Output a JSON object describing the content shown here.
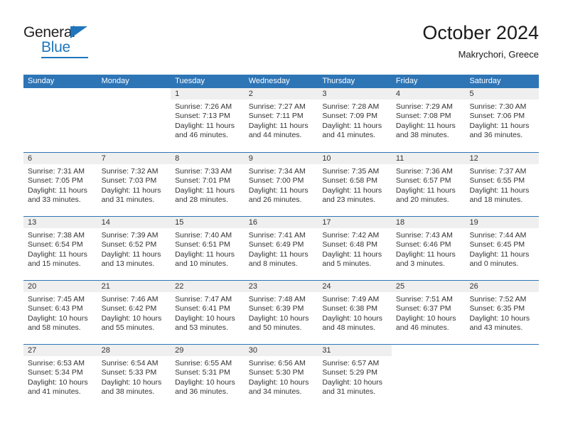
{
  "brand": {
    "name_top": "General",
    "name_bottom": "Blue",
    "accent_color": "#1f76bc"
  },
  "header": {
    "title": "October 2024",
    "subtitle": "Makrychori, Greece"
  },
  "theme": {
    "header_blue": "#2e75b6",
    "day_band_gray": "#efefef",
    "text_color": "#333333"
  },
  "weekdays": [
    "Sunday",
    "Monday",
    "Tuesday",
    "Wednesday",
    "Thursday",
    "Friday",
    "Saturday"
  ],
  "weeks": [
    [
      {
        "day": "",
        "lines": [],
        "blank": true
      },
      {
        "day": "",
        "lines": [],
        "blank": true
      },
      {
        "day": "1",
        "lines": [
          "Sunrise: 7:26 AM",
          "Sunset: 7:13 PM",
          "Daylight: 11 hours",
          "and 46 minutes."
        ]
      },
      {
        "day": "2",
        "lines": [
          "Sunrise: 7:27 AM",
          "Sunset: 7:11 PM",
          "Daylight: 11 hours",
          "and 44 minutes."
        ]
      },
      {
        "day": "3",
        "lines": [
          "Sunrise: 7:28 AM",
          "Sunset: 7:09 PM",
          "Daylight: 11 hours",
          "and 41 minutes."
        ]
      },
      {
        "day": "4",
        "lines": [
          "Sunrise: 7:29 AM",
          "Sunset: 7:08 PM",
          "Daylight: 11 hours",
          "and 38 minutes."
        ]
      },
      {
        "day": "5",
        "lines": [
          "Sunrise: 7:30 AM",
          "Sunset: 7:06 PM",
          "Daylight: 11 hours",
          "and 36 minutes."
        ]
      }
    ],
    [
      {
        "day": "6",
        "lines": [
          "Sunrise: 7:31 AM",
          "Sunset: 7:05 PM",
          "Daylight: 11 hours",
          "and 33 minutes."
        ]
      },
      {
        "day": "7",
        "lines": [
          "Sunrise: 7:32 AM",
          "Sunset: 7:03 PM",
          "Daylight: 11 hours",
          "and 31 minutes."
        ]
      },
      {
        "day": "8",
        "lines": [
          "Sunrise: 7:33 AM",
          "Sunset: 7:01 PM",
          "Daylight: 11 hours",
          "and 28 minutes."
        ]
      },
      {
        "day": "9",
        "lines": [
          "Sunrise: 7:34 AM",
          "Sunset: 7:00 PM",
          "Daylight: 11 hours",
          "and 26 minutes."
        ]
      },
      {
        "day": "10",
        "lines": [
          "Sunrise: 7:35 AM",
          "Sunset: 6:58 PM",
          "Daylight: 11 hours",
          "and 23 minutes."
        ]
      },
      {
        "day": "11",
        "lines": [
          "Sunrise: 7:36 AM",
          "Sunset: 6:57 PM",
          "Daylight: 11 hours",
          "and 20 minutes."
        ]
      },
      {
        "day": "12",
        "lines": [
          "Sunrise: 7:37 AM",
          "Sunset: 6:55 PM",
          "Daylight: 11 hours",
          "and 18 minutes."
        ]
      }
    ],
    [
      {
        "day": "13",
        "lines": [
          "Sunrise: 7:38 AM",
          "Sunset: 6:54 PM",
          "Daylight: 11 hours",
          "and 15 minutes."
        ]
      },
      {
        "day": "14",
        "lines": [
          "Sunrise: 7:39 AM",
          "Sunset: 6:52 PM",
          "Daylight: 11 hours",
          "and 13 minutes."
        ]
      },
      {
        "day": "15",
        "lines": [
          "Sunrise: 7:40 AM",
          "Sunset: 6:51 PM",
          "Daylight: 11 hours",
          "and 10 minutes."
        ]
      },
      {
        "day": "16",
        "lines": [
          "Sunrise: 7:41 AM",
          "Sunset: 6:49 PM",
          "Daylight: 11 hours",
          "and 8 minutes."
        ]
      },
      {
        "day": "17",
        "lines": [
          "Sunrise: 7:42 AM",
          "Sunset: 6:48 PM",
          "Daylight: 11 hours",
          "and 5 minutes."
        ]
      },
      {
        "day": "18",
        "lines": [
          "Sunrise: 7:43 AM",
          "Sunset: 6:46 PM",
          "Daylight: 11 hours",
          "and 3 minutes."
        ]
      },
      {
        "day": "19",
        "lines": [
          "Sunrise: 7:44 AM",
          "Sunset: 6:45 PM",
          "Daylight: 11 hours",
          "and 0 minutes."
        ]
      }
    ],
    [
      {
        "day": "20",
        "lines": [
          "Sunrise: 7:45 AM",
          "Sunset: 6:43 PM",
          "Daylight: 10 hours",
          "and 58 minutes."
        ]
      },
      {
        "day": "21",
        "lines": [
          "Sunrise: 7:46 AM",
          "Sunset: 6:42 PM",
          "Daylight: 10 hours",
          "and 55 minutes."
        ]
      },
      {
        "day": "22",
        "lines": [
          "Sunrise: 7:47 AM",
          "Sunset: 6:41 PM",
          "Daylight: 10 hours",
          "and 53 minutes."
        ]
      },
      {
        "day": "23",
        "lines": [
          "Sunrise: 7:48 AM",
          "Sunset: 6:39 PM",
          "Daylight: 10 hours",
          "and 50 minutes."
        ]
      },
      {
        "day": "24",
        "lines": [
          "Sunrise: 7:49 AM",
          "Sunset: 6:38 PM",
          "Daylight: 10 hours",
          "and 48 minutes."
        ]
      },
      {
        "day": "25",
        "lines": [
          "Sunrise: 7:51 AM",
          "Sunset: 6:37 PM",
          "Daylight: 10 hours",
          "and 46 minutes."
        ]
      },
      {
        "day": "26",
        "lines": [
          "Sunrise: 7:52 AM",
          "Sunset: 6:35 PM",
          "Daylight: 10 hours",
          "and 43 minutes."
        ]
      }
    ],
    [
      {
        "day": "27",
        "lines": [
          "Sunrise: 6:53 AM",
          "Sunset: 5:34 PM",
          "Daylight: 10 hours",
          "and 41 minutes."
        ]
      },
      {
        "day": "28",
        "lines": [
          "Sunrise: 6:54 AM",
          "Sunset: 5:33 PM",
          "Daylight: 10 hours",
          "and 38 minutes."
        ]
      },
      {
        "day": "29",
        "lines": [
          "Sunrise: 6:55 AM",
          "Sunset: 5:31 PM",
          "Daylight: 10 hours",
          "and 36 minutes."
        ]
      },
      {
        "day": "30",
        "lines": [
          "Sunrise: 6:56 AM",
          "Sunset: 5:30 PM",
          "Daylight: 10 hours",
          "and 34 minutes."
        ]
      },
      {
        "day": "31",
        "lines": [
          "Sunrise: 6:57 AM",
          "Sunset: 5:29 PM",
          "Daylight: 10 hours",
          "and 31 minutes."
        ]
      },
      {
        "day": "",
        "lines": [],
        "blank": true
      },
      {
        "day": "",
        "lines": [],
        "blank": true
      }
    ]
  ]
}
